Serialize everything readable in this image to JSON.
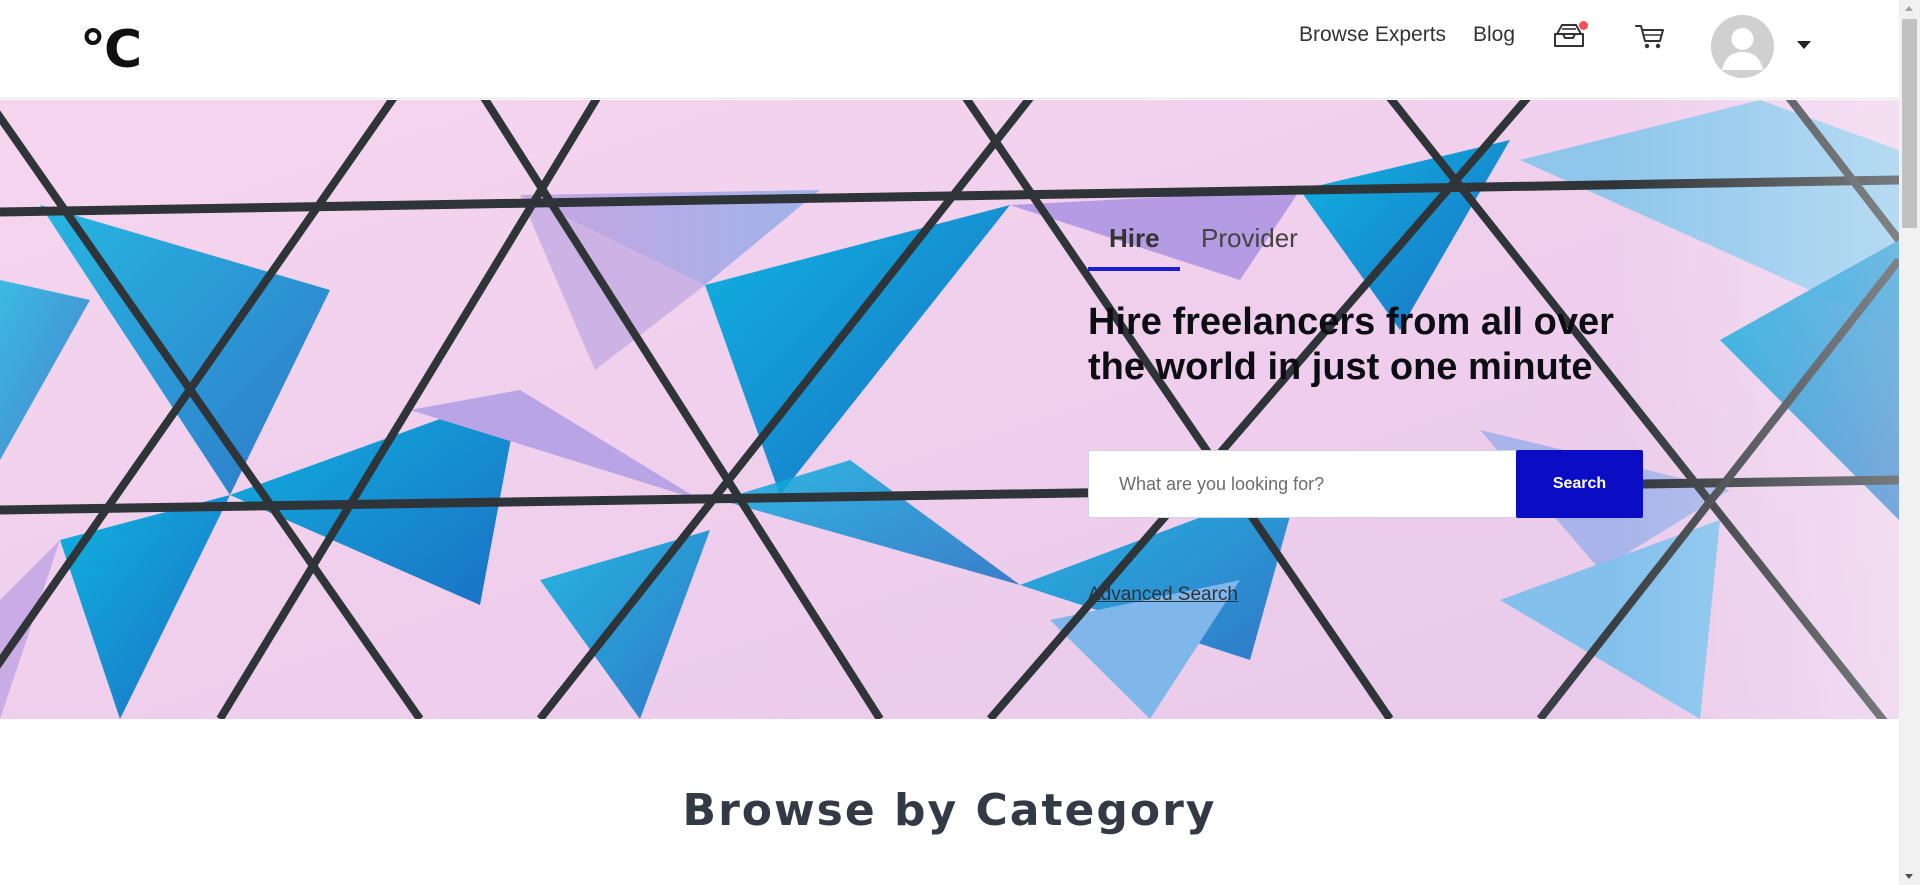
{
  "header": {
    "logo": "°C",
    "nav": {
      "browse_experts": "Browse Experts",
      "blog": "Blog"
    },
    "icons": {
      "inbox": "inbox-icon",
      "cart": "cart-icon",
      "avatar": "avatar",
      "menu_caret": "caret-down-icon"
    },
    "notification_dot_color": "#ff4d5a"
  },
  "hero": {
    "tabs": [
      {
        "label": "Hire",
        "active": true
      },
      {
        "label": "Provider",
        "active": false
      }
    ],
    "headline": "Hire freelancers from all over the world in just one minute",
    "search": {
      "placeholder": "What are you looking for?",
      "button_label": "Search"
    },
    "advanced_search": "Advanced Search",
    "accent_color": "#0a0dc4"
  },
  "category": {
    "title": "Browse by Category"
  }
}
